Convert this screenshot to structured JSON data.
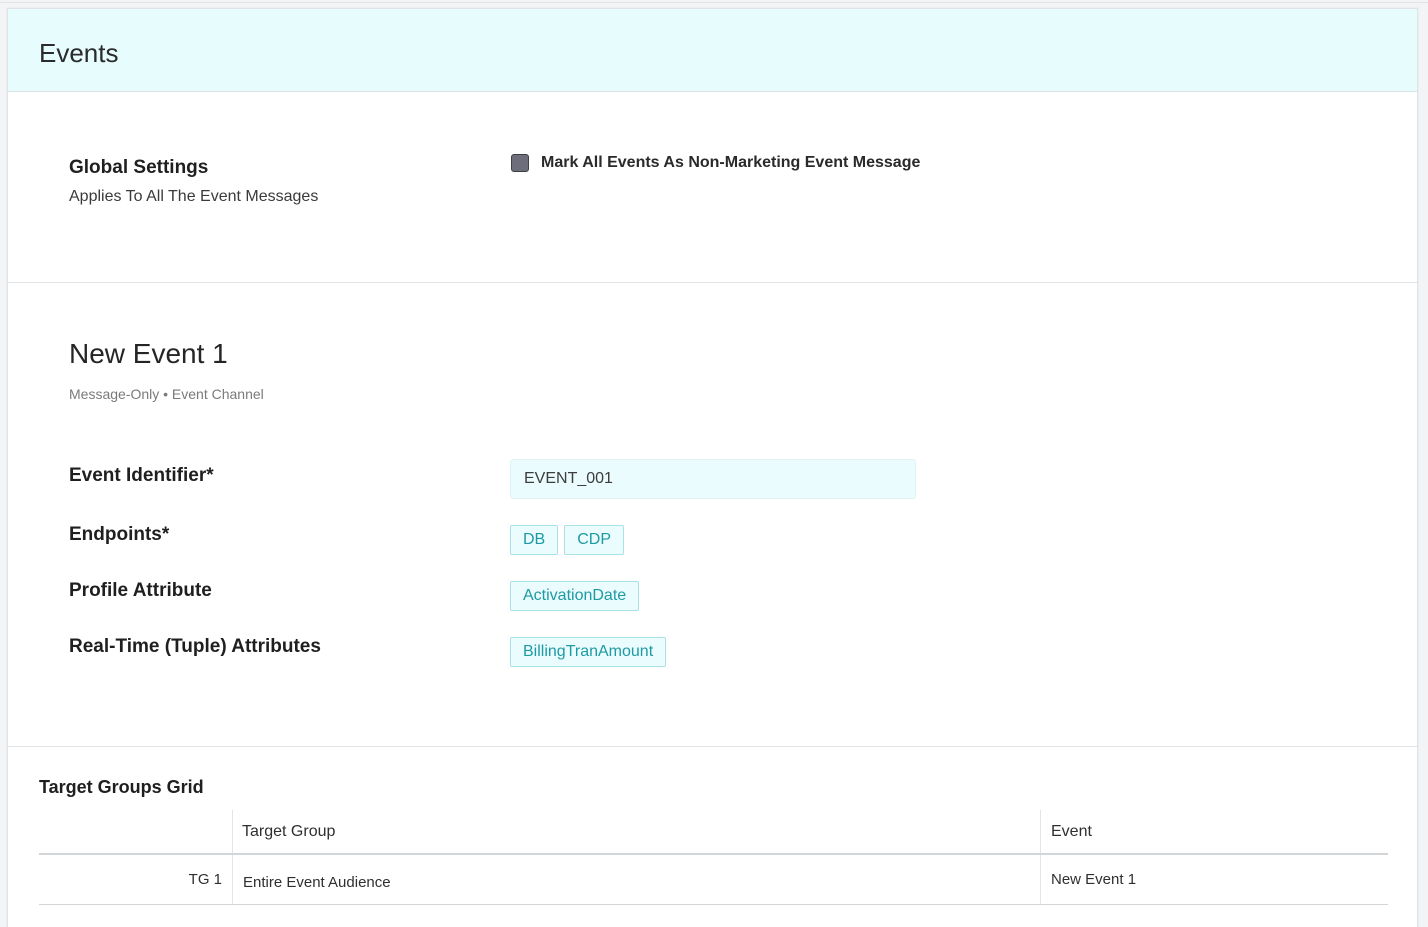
{
  "header": {
    "title": "Events"
  },
  "global_settings": {
    "title": "Global Settings",
    "subtitle": "Applies To All The Event Messages",
    "checkbox_label": "Mark All Events As Non-Marketing Event Message",
    "checkbox_checked": false
  },
  "event": {
    "title": "New Event 1",
    "subtitle": "Message-Only • Event Channel",
    "fields": {
      "identifier_label": "Event Identifier*",
      "identifier_value": "EVENT_001",
      "endpoints_label": "Endpoints*",
      "endpoints": [
        "DB",
        "CDP"
      ],
      "profile_label": "Profile Attribute",
      "profile_attributes": [
        "ActivationDate"
      ],
      "realtime_label": "Real-Time (Tuple) Attributes",
      "realtime_attributes": [
        "BillingTranAmount"
      ]
    }
  },
  "grid": {
    "title": "Target Groups Grid",
    "columns": [
      "",
      "Target Group",
      "Event"
    ],
    "rows": [
      {
        "id": "TG 1",
        "target_group": "Entire Event Audience",
        "event": "New Event 1"
      }
    ]
  },
  "colors": {
    "header_bg": "#e6fcfd",
    "chip_text": "#1e9aa3",
    "chip_border": "#a9e3e7",
    "input_bg": "#eafcfd"
  }
}
